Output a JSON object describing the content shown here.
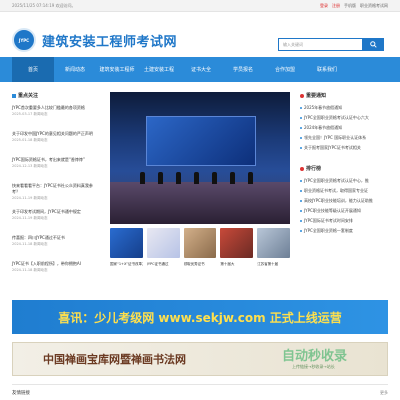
{
  "topbar": {
    "date": "2025/11/25 07:14:19 欢迎访问。",
    "links": [
      "登录",
      "注册",
      "手机版",
      "职业资格考试网"
    ]
  },
  "header": {
    "logo_text": "JYPC",
    "title": "建筑安装工程师考试网",
    "search_placeholder": "输入关键词"
  },
  "nav": {
    "items": [
      "首页",
      "新闻动态",
      "建筑安装工程师",
      "土建安装工程",
      "证书大全",
      "学员报名",
      "合作加盟",
      "联系我们"
    ]
  },
  "left": {
    "title": "重点关注",
    "items": [
      {
        "text": "JYPC首次重要多人比较门槛最的各项资格",
        "meta": "2025-03-17  新闻动态"
      },
      {
        "text": "关于印发中国JYPC的意见相关问题的严正声明",
        "meta": "2025-01-18  新闻动态"
      },
      {
        "text": "JYPC国际资格证书，考出来就是“香饽饽”",
        "meta": "2024-12-13  新闻动态"
      },
      {
        "text": "快来看看看平台：JYPC证书社公众资料真我参考？",
        "meta": "2024-11-19  新闻动态"
      },
      {
        "text": "关于印发考试期间，JYPC证书通中规定",
        "meta": "2024-11-19  新闻动态"
      },
      {
        "text": "传喜报：四川JYPC通过不证书",
        "meta": "2024-11-18  新闻动态"
      },
      {
        "text": "JYPC证书【入职前程所】，带你拥抱AI",
        "meta": "2024-11-18  新闻动态"
      }
    ]
  },
  "center": {
    "thumb_captions": [
      "国家“1+X”证书改革方",
      "JYPC证书通过",
      "领取优秀证书",
      "第十届大",
      "江苏省第十届"
    ],
    "thumb_labels": [
      "传 喜 报",
      "JYPC证书",
      "",
      "",
      ""
    ]
  },
  "right": {
    "news_title": "重要通知",
    "news": [
      "2025年春节放假通知",
      "JYPC全国职业资格考试认证中心六大",
      "2024年春节放假通知",
      "领先全国！JYPC 国际职业认证体系",
      "关于报考国家JYPC证书考试相关"
    ],
    "rank_title": "排行榜",
    "rank": [
      "JYPC全国职业资格考试认证中心，推",
      "职业资格证书考试，取得国家专业证",
      "高校JYPC职业技能培训，能力认证助推",
      "JYPC职业技能等级认证开展通知",
      "JYPC国际证书考试时间安排",
      "JYPC全国职业资格一套制度"
    ]
  },
  "banner1": {
    "text": "喜讯：少儿考级网 www.sekjw.com 正式上线运营"
  },
  "banner2": {
    "text": "中国禅画宝库网暨禅画书法网"
  },
  "watermark": {
    "text": "自动秒收录",
    "sub": "上传链接→秒收录→站长"
  },
  "footer": {
    "label": "友情链接",
    "more": "更多"
  },
  "colors": {
    "brand": "#1f77c8",
    "nav": "#2b8bd9",
    "nav_active": "#1a6bb0",
    "highlight": "#ffe04d"
  }
}
